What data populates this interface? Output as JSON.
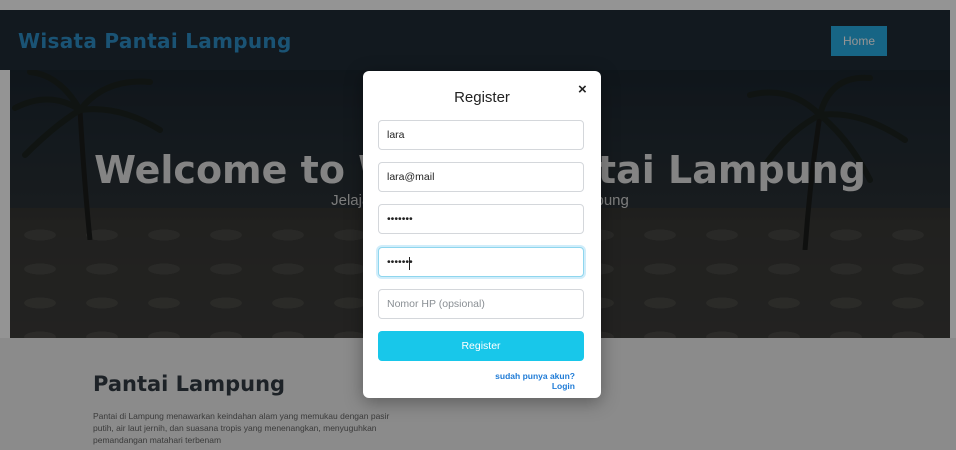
{
  "navbar": {
    "brand": "Wisata Pantai Lampung",
    "home_label": "Home"
  },
  "hero": {
    "title": "Welcome to Wisata Pantai Lampung",
    "subtitle": "Jelajahi keindahan pantai-pantai di Lampung"
  },
  "section": {
    "title": "Pantai Lampung",
    "text": "Pantai di Lampung menawarkan keindahan alam yang memukau dengan pasir putih, air laut jernih, dan suasana tropis yang menenangkan, menyuguhkan pemandangan matahari terbenam"
  },
  "modal": {
    "title": "Register",
    "close_symbol": "×",
    "name_value": "lara",
    "email_value": "lara@mail",
    "password_value": "•••••••",
    "confirm_value": "•••••••",
    "phone_placeholder": "Nomor HP (opsional)",
    "submit_label": "Register",
    "login_link": "sudah punya akun? Login"
  }
}
